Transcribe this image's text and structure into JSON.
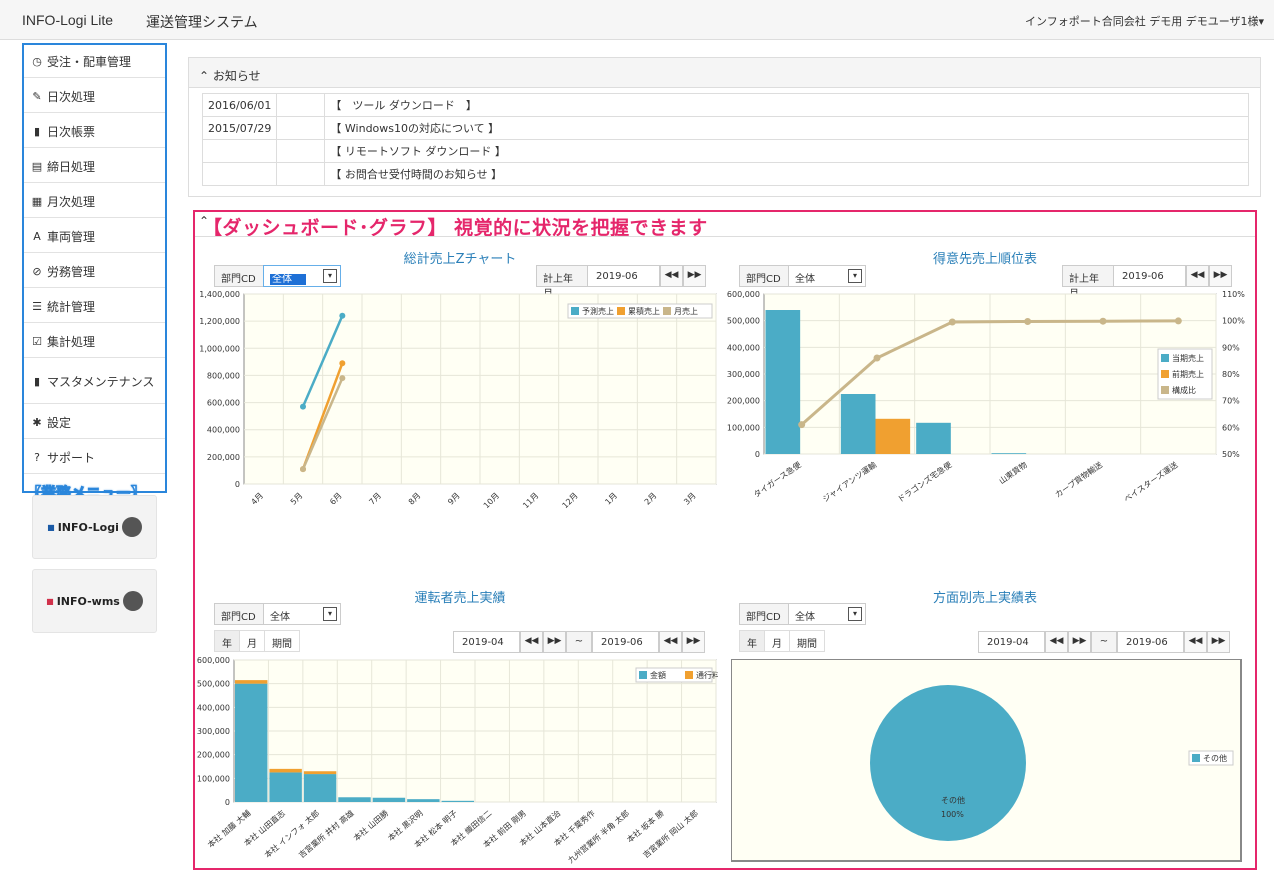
{
  "header": {
    "brand": "INFO-Logi Lite",
    "system": "運送管理システム",
    "user": "インフォポート合同会社 デモ用 デモユーザ1様▾"
  },
  "sidebar": {
    "items": [
      {
        "icon": "dashboard-icon",
        "glyph": "◷",
        "label": "受注・配車管理"
      },
      {
        "icon": "pencil-icon",
        "glyph": "✎",
        "label": "日次処理"
      },
      {
        "icon": "file-icon",
        "glyph": "▮",
        "label": "日次帳票"
      },
      {
        "icon": "list-icon",
        "glyph": "▤",
        "label": "締日処理"
      },
      {
        "icon": "calendar-icon",
        "glyph": "▦",
        "label": "月次処理"
      },
      {
        "icon": "road-icon",
        "glyph": "A",
        "label": "車両管理"
      },
      {
        "icon": "paperclip-icon",
        "glyph": "⊘",
        "label": "労務管理"
      },
      {
        "icon": "list-ul-icon",
        "glyph": "☰",
        "label": "統計管理"
      },
      {
        "icon": "check-square-icon",
        "glyph": "☑",
        "label": "集計処理"
      },
      {
        "icon": "book-icon",
        "glyph": "▮",
        "label": "マスタメンテナンス"
      },
      {
        "icon": "gear-icon",
        "glyph": "✱",
        "label": "設定"
      },
      {
        "icon": "question-icon",
        "glyph": "?",
        "label": "サポート"
      }
    ],
    "annotation": "【業務メニュー】"
  },
  "logos": {
    "logo1": "INFO-Logi",
    "logo2": "INFO-wms"
  },
  "notice": {
    "title": "お知らせ",
    "rows": [
      {
        "date": "2016/06/01",
        "text": "【　ツール ダウンロード　】"
      },
      {
        "date": "2015/07/29",
        "text": "【 Windows10の対応について 】"
      },
      {
        "date": "",
        "text": "【 リモートソフト ダウンロード 】"
      },
      {
        "date": "",
        "text": "【 お問合せ受付時間のお知らせ 】"
      }
    ]
  },
  "dashboard": {
    "annotation": "【ダッシュボード･グラフ】 視覚的に状況を把握できます",
    "controls": {
      "dept_label": "部門CD",
      "dept_value": "全体",
      "month_label": "計上年月",
      "month_value": "2019-06",
      "seg_year": "年",
      "seg_month": "月",
      "seg_period": "期間",
      "from": "2019-04",
      "to": "2019-06",
      "tilde": "~",
      "prev": "◀◀",
      "next": "▶▶"
    }
  },
  "chart_data": [
    {
      "type": "line",
      "title": "総計売上Zチャート",
      "categories": [
        "4月",
        "5月",
        "6月",
        "7月",
        "8月",
        "9月",
        "10月",
        "11月",
        "12月",
        "1月",
        "2月",
        "3月"
      ],
      "series": [
        {
          "name": "予測売上",
          "color": "#4bacc6",
          "values": [
            null,
            570000,
            1240000,
            null,
            null,
            null,
            null,
            null,
            null,
            null,
            null,
            null
          ]
        },
        {
          "name": "累積売上",
          "color": "#f0a030",
          "values": [
            null,
            110000,
            890000,
            null,
            null,
            null,
            null,
            null,
            null,
            null,
            null,
            null
          ]
        },
        {
          "name": "月売上",
          "color": "#c9b68a",
          "values": [
            null,
            110000,
            780000,
            null,
            null,
            null,
            null,
            null,
            null,
            null,
            null,
            null
          ]
        }
      ],
      "yticks": [
        "0",
        "200,000",
        "400,000",
        "600,000",
        "800,000",
        "1,000,000",
        "1,200,000",
        "1,400,000"
      ],
      "ylim": [
        0,
        1400000
      ]
    },
    {
      "type": "bar",
      "title": "得意先売上順位表",
      "categories": [
        "タイガース急便",
        "ジャイアンツ運輸",
        "ドラゴンズ宅急便",
        "山東貨物",
        "カープ貨物輸送",
        "ベイスターズ運送"
      ],
      "series": [
        {
          "name": "当期売上",
          "color": "#4bacc6",
          "values": [
            540000,
            225000,
            117000,
            3000,
            0,
            0
          ]
        },
        {
          "name": "前期売上",
          "color": "#f0a030",
          "values": [
            0,
            132000,
            0,
            0,
            0,
            0
          ]
        },
        {
          "name": "構成比",
          "color": "#c9b68a",
          "values": [
            61,
            86,
            99.5,
            99.7,
            99.8,
            99.9
          ]
        }
      ],
      "yticks": [
        "0",
        "100,000",
        "200,000",
        "300,000",
        "400,000",
        "500,000",
        "600,000"
      ],
      "y2ticks": [
        "50%",
        "60%",
        "70%",
        "80%",
        "90%",
        "100%",
        "110%"
      ],
      "ylim": [
        0,
        600000
      ],
      "y2lim": [
        50,
        110
      ]
    },
    {
      "type": "bar",
      "title": "運転者売上実績",
      "categories": [
        "本社 加藤 大輔",
        "本社 山田直志",
        "本社 インフォ 太郎",
        "吉宮業所 井村 高雄",
        "本社 山田勝",
        "本社 黒沢明",
        "本社 松本 明子",
        "本社 織田信二",
        "本社 前田 剛男",
        "本社 山本直治",
        "本社 千葉秀作",
        "九州営業所 半角 太郎",
        "本社 坂本 勝",
        "吉宮業所 岡山 太郎"
      ],
      "series": [
        {
          "name": "金額",
          "color": "#4bacc6",
          "values": [
            500000,
            125000,
            118000,
            20000,
            18000,
            12000,
            5000,
            0,
            0,
            0,
            0,
            0,
            0,
            0
          ]
        },
        {
          "name": "通行料",
          "color": "#f0a030",
          "values": [
            15000,
            15000,
            12000,
            0,
            0,
            0,
            0,
            0,
            0,
            0,
            0,
            0,
            0,
            0
          ]
        }
      ],
      "yticks": [
        "0",
        "100,000",
        "200,000",
        "300,000",
        "400,000",
        "500,000",
        "600,000"
      ],
      "ylim": [
        0,
        600000
      ]
    },
    {
      "type": "pie",
      "title": "方面別売上実績表",
      "slices": [
        {
          "name": "その他",
          "value": 100,
          "label": "100%",
          "color": "#4bacc6"
        }
      ]
    }
  ]
}
